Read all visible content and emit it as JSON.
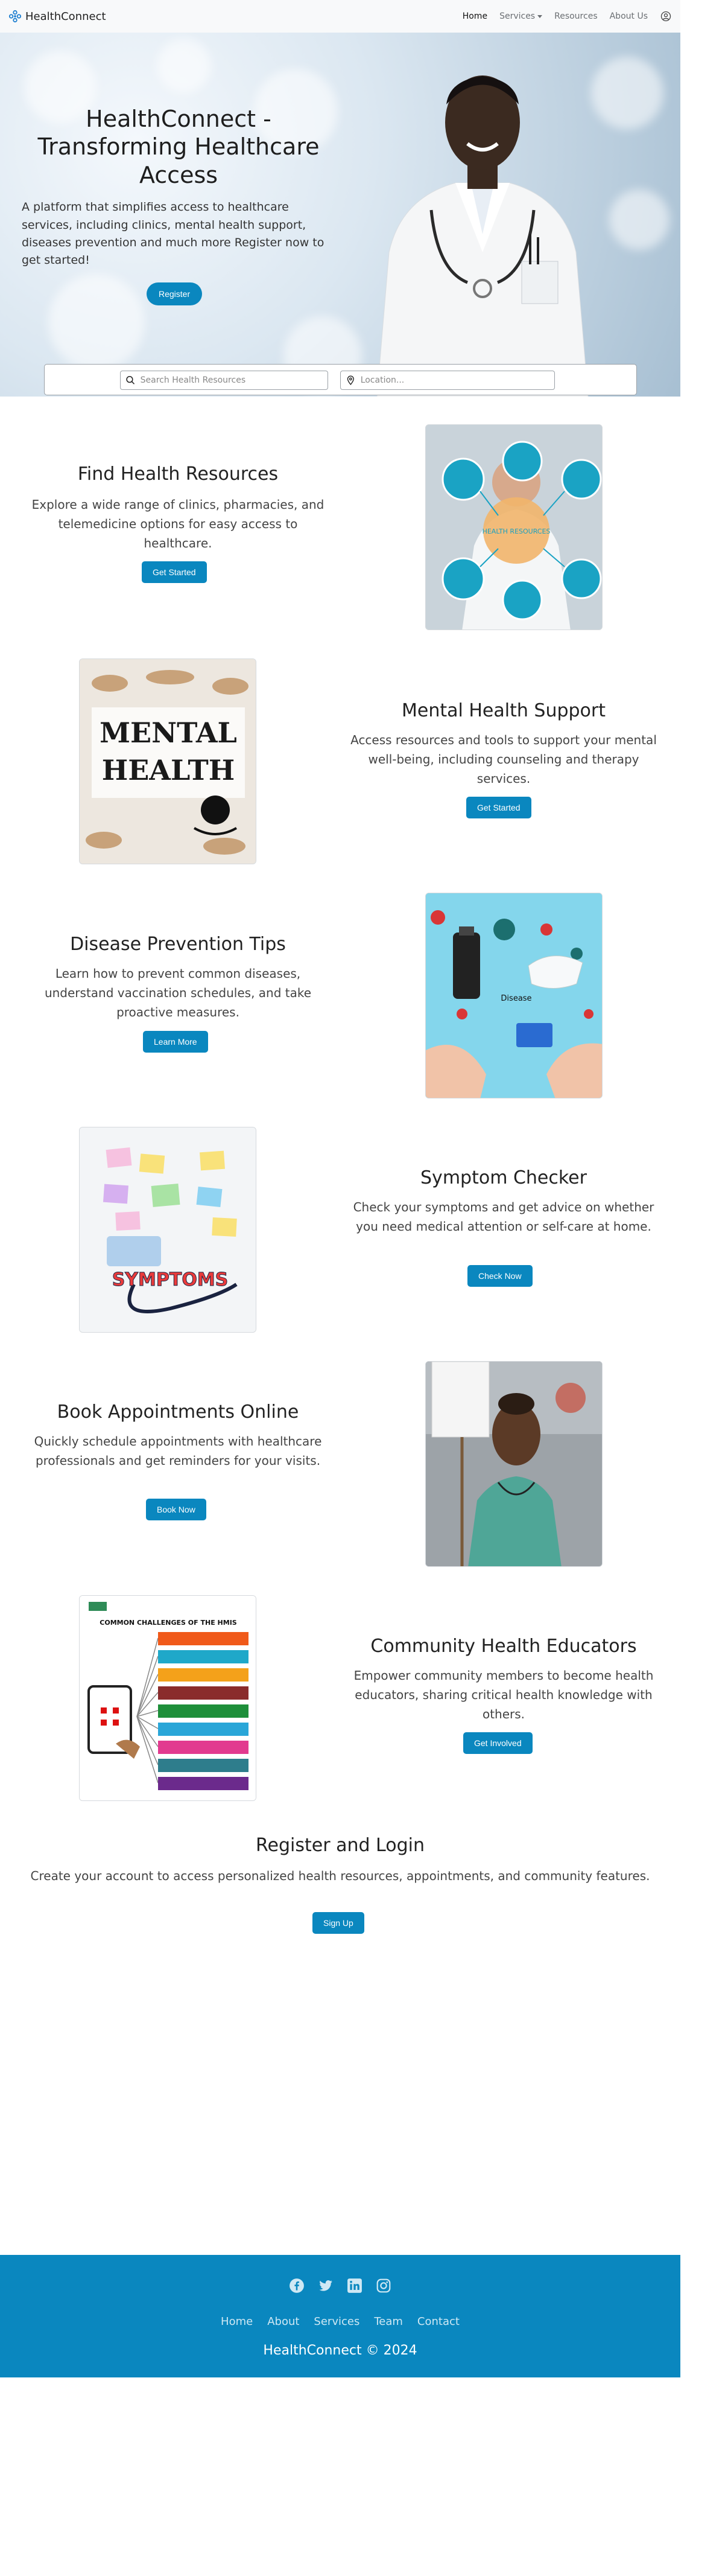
{
  "navbar": {
    "brand": "HealthConnect",
    "links": [
      {
        "label": "Home"
      },
      {
        "label": "Services"
      },
      {
        "label": "Resources"
      },
      {
        "label": "About Us"
      }
    ]
  },
  "hero": {
    "title": "HealthConnect - Transforming Healthcare Access",
    "description": "A platform that simplifies access to healthcare services, including clinics, mental health support, diseases prevention and much more Register now to get started!",
    "button": "Register"
  },
  "search": {
    "resources_placeholder": "Search Health Resources",
    "location_placeholder": "Location..."
  },
  "features": [
    {
      "title": "Find Health Resources",
      "description": "Explore a wide range of clinics, pharmacies, and telemedicine options for easy access to healthcare.",
      "button": "Get Started",
      "image_text": "HEALTH RESOURCES"
    },
    {
      "title": "Mental Health Support",
      "description": "Access resources and tools to support your mental well-being, including counseling and therapy services.",
      "button": "Get Started",
      "image_text_1": "MENTAL",
      "image_text_2": "HEALTH"
    },
    {
      "title": "Disease Prevention Tips",
      "description": "Learn how to prevent common diseases, understand vaccination schedules, and take proactive measures.",
      "button": "Learn More",
      "image_text": "Disease"
    },
    {
      "title": "Symptom Checker",
      "description": "Check your symptoms and get advice on whether you need medical attention or self-care at home.",
      "button": "Check Now",
      "image_text": "SYMPTOMS"
    },
    {
      "title": "Book Appointments Online",
      "description": "Quickly schedule appointments with healthcare professionals and get reminders for your visits.",
      "button": "Book Now"
    },
    {
      "title": "Community Health Educators",
      "description": "Empower community members to become health educators, sharing critical health knowledge with others.",
      "button": "Get Involved",
      "image_text": "COMMON CHALLENGES OF THE HMIS"
    }
  ],
  "register": {
    "title": "Register and Login",
    "description": "Create your account to access personalized health resources, appointments, and community features.",
    "button": "Sign Up"
  },
  "footer": {
    "social": [
      "facebook-icon",
      "twitter-icon",
      "linkedin-icon",
      "instagram-icon"
    ],
    "links": [
      {
        "label": "Home"
      },
      {
        "label": "About"
      },
      {
        "label": "Services"
      },
      {
        "label": "Team"
      },
      {
        "label": "Contact"
      }
    ],
    "copyright": "HealthConnect © 2024"
  },
  "colors": {
    "accent": "#0a87bf",
    "navbar_bg": "#f8f9fa",
    "footer_bg": "#0a87bf"
  }
}
